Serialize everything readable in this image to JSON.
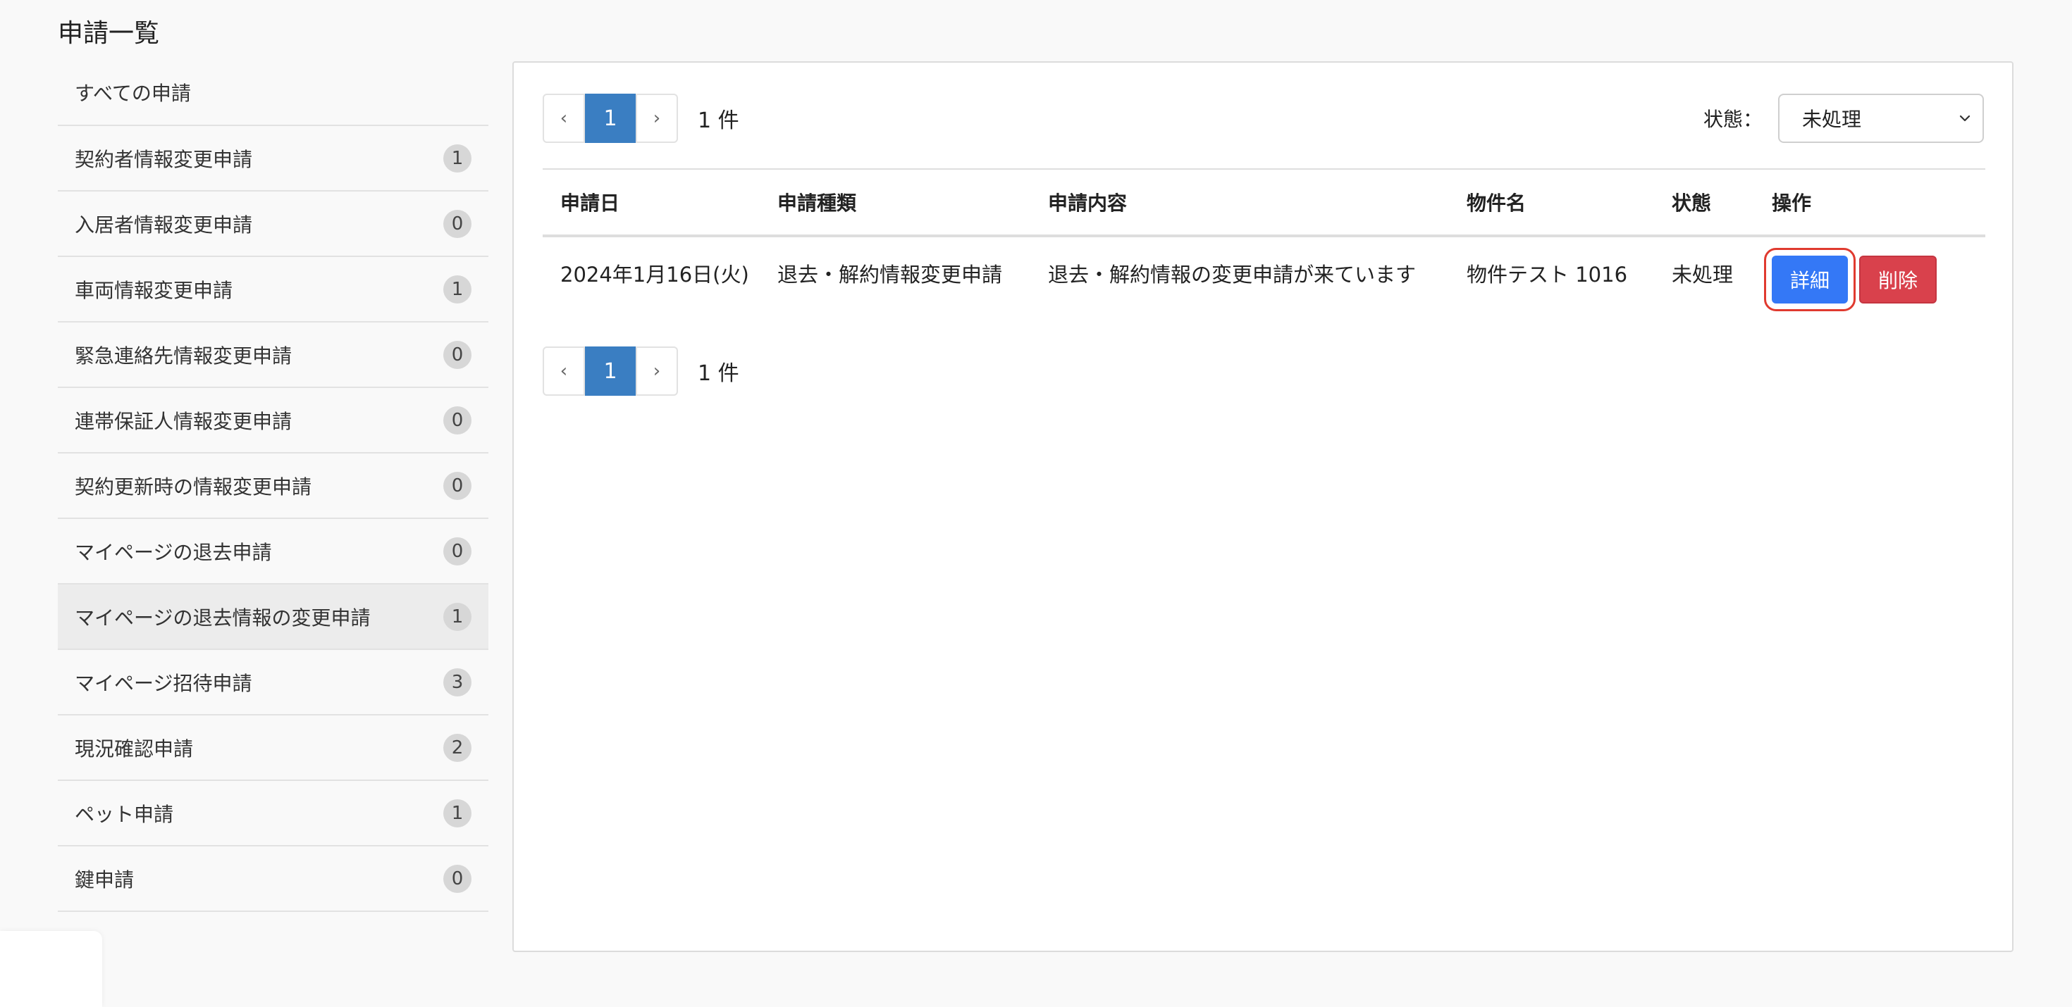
{
  "page": {
    "title": "申請一覧"
  },
  "sidebar": {
    "items": [
      {
        "label": "すべての申請",
        "count": ""
      },
      {
        "label": "契約者情報変更申請",
        "count": "1"
      },
      {
        "label": "入居者情報変更申請",
        "count": "0"
      },
      {
        "label": "車両情報変更申請",
        "count": "1"
      },
      {
        "label": "緊急連絡先情報変更申請",
        "count": "0"
      },
      {
        "label": "連帯保証人情報変更申請",
        "count": "0"
      },
      {
        "label": "契約更新時の情報変更申請",
        "count": "0"
      },
      {
        "label": "マイページの退去申請",
        "count": "0"
      },
      {
        "label": "マイページの退去情報の変更申請",
        "count": "1"
      },
      {
        "label": "マイページ招待申請",
        "count": "3"
      },
      {
        "label": "現況確認申請",
        "count": "2"
      },
      {
        "label": "ペット申請",
        "count": "1"
      },
      {
        "label": "鍵申請",
        "count": "0"
      }
    ],
    "active_index": 8
  },
  "pagination": {
    "prev": "‹",
    "current": "1",
    "next": "›",
    "count_text": "1 件"
  },
  "filter": {
    "label": "状態：",
    "selected": "未処理"
  },
  "table": {
    "headers": [
      "申請日",
      "申請種類",
      "申請内容",
      "物件名",
      "状態",
      "操作"
    ],
    "rows": [
      {
        "date": "2024年1月16日(火)",
        "type": "退去・解約情報変更申請",
        "content": "退去・解約情報の変更申請が来ています",
        "property": "物件テスト 1016",
        "status": "未処理",
        "detail_label": "詳細",
        "delete_label": "削除"
      }
    ]
  },
  "colors": {
    "primary_button": "#3478f6",
    "danger_button": "#d9414c",
    "pager_active": "#3a7ec2",
    "highlight_outline": "#e03a2f"
  }
}
